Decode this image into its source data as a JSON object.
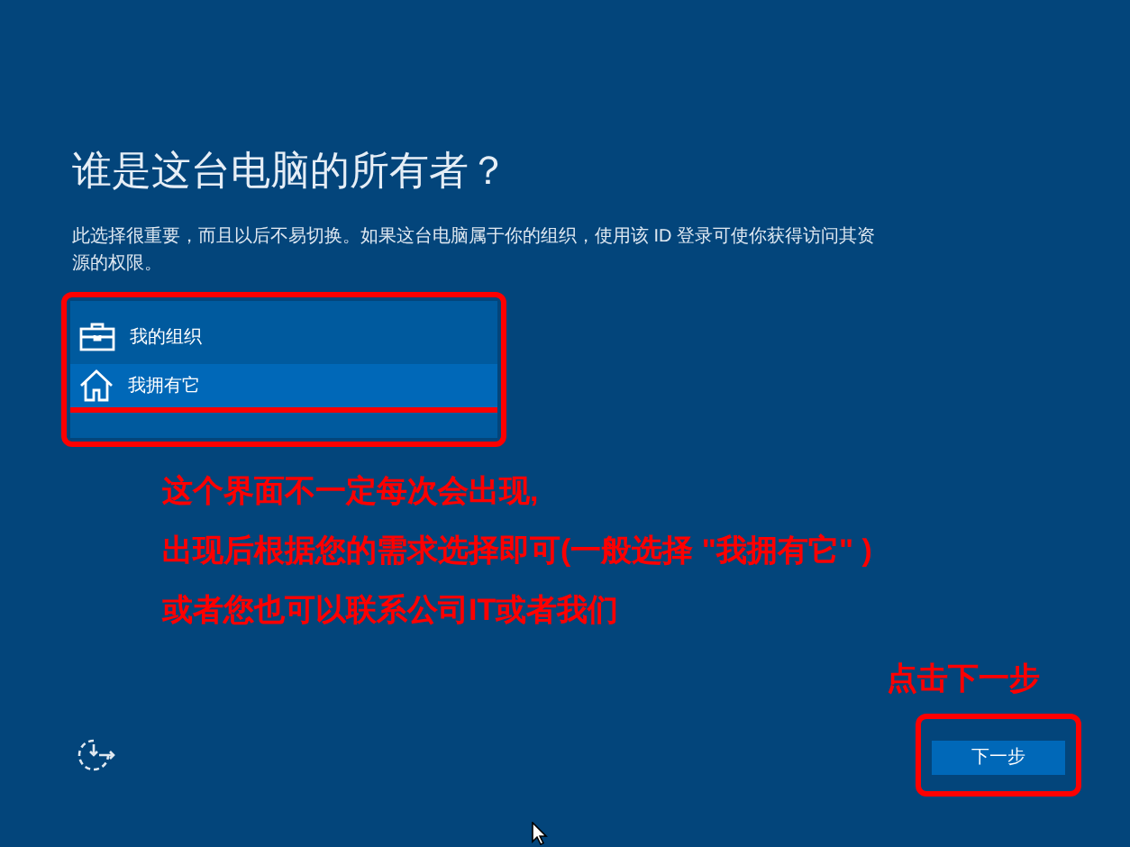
{
  "title": "谁是这台电脑的所有者？",
  "description": "此选择很重要，而且以后不易切换。如果这台电脑属于你的组织，使用该 ID 登录可使你获得访问其资源的权限。",
  "options": [
    {
      "label": "我的组织",
      "kind": "organization",
      "selected": false
    },
    {
      "label": "我拥有它",
      "kind": "personal",
      "selected": true
    }
  ],
  "notes": [
    "这个界面不一定每次会出现,",
    "出现后根据您的需求选择即可(一般选择 \"我拥有它\" )",
    "或者您也可以联系公司IT或者我们"
  ],
  "next_hint": "点击下一步",
  "next_button": "下一步"
}
